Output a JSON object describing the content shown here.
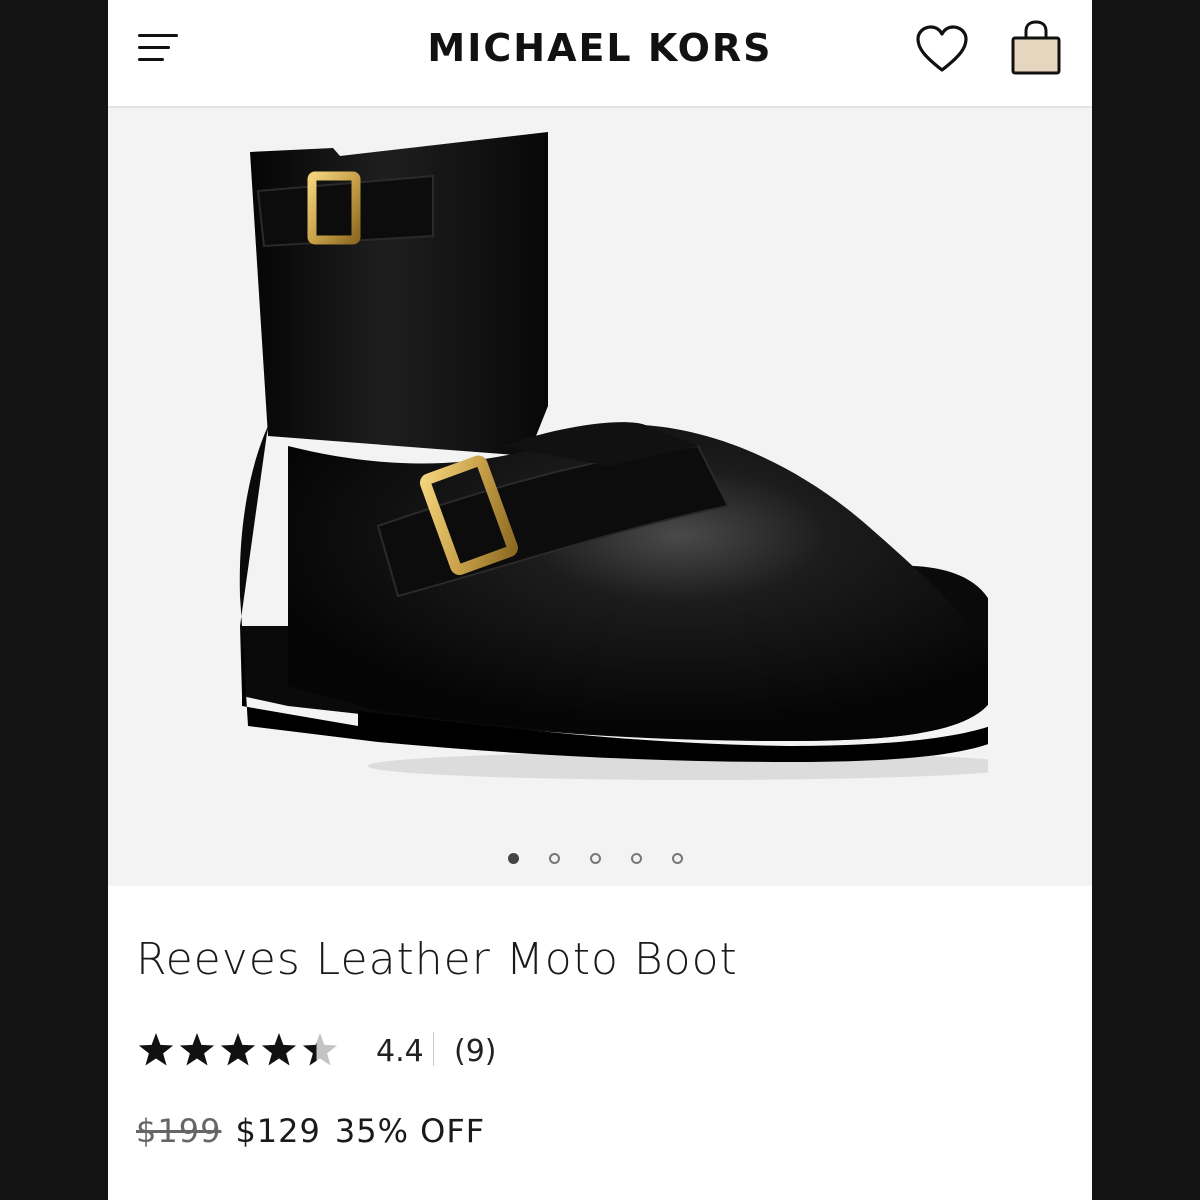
{
  "header": {
    "brand": "MICHAEL KORS",
    "icons": [
      "menu-icon",
      "heart-icon",
      "shopping-bag-icon"
    ]
  },
  "gallery": {
    "image_count": 5,
    "active_index": 0
  },
  "product": {
    "title": "Reeves Leather Moto Boot",
    "rating": {
      "stars": 4.4,
      "value": "4.4",
      "count": "(9)"
    },
    "price": {
      "original": "$199",
      "sale": "$129",
      "discount": "35% OFF"
    }
  },
  "colors": {
    "background": "#141414",
    "bag_fill": "#e6d6bf",
    "image_bg": "#f3f3f3",
    "buckle_gold": "#c9a24a"
  }
}
